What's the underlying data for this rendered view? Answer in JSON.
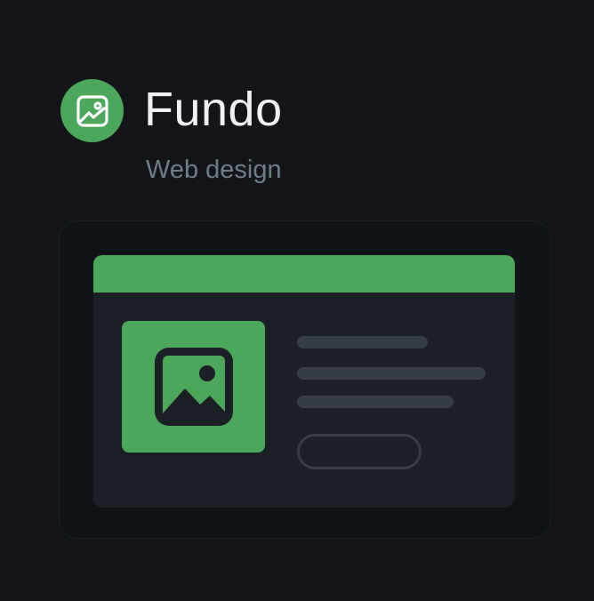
{
  "brand": {
    "title": "Fundo",
    "subtitle": "Web design",
    "logo_icon": "image-icon"
  },
  "colors": {
    "accent": "#4ca75a",
    "background": "#131519",
    "panel": "#1b1f26",
    "placeholder": "#373d45"
  },
  "mockup": {
    "image_icon": "image-mountain-icon"
  }
}
